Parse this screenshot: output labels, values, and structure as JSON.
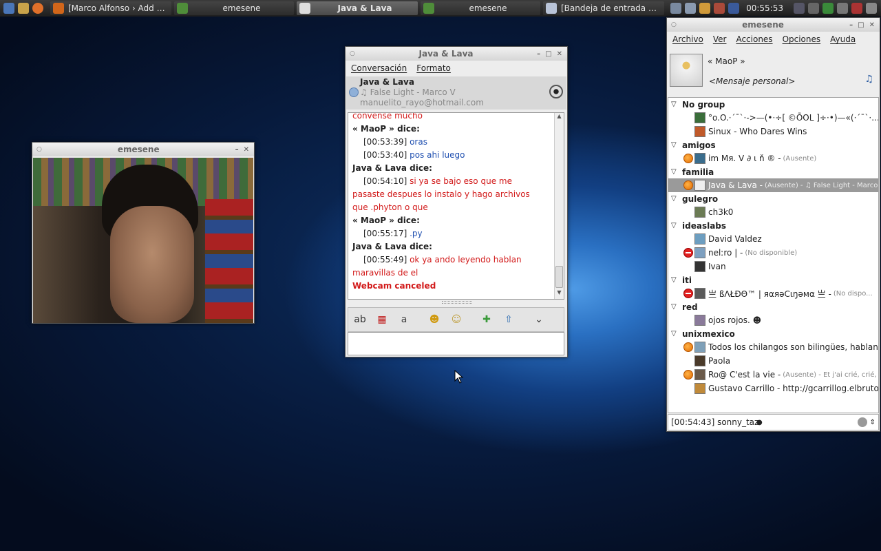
{
  "taskbar": {
    "tasks": [
      {
        "label": "[Marco Alfonso › Add Ne...",
        "icon": "firefox-icon",
        "color": "#d2661a",
        "active": false
      },
      {
        "label": "emesene",
        "icon": "emesene-icon",
        "color": "#4f8d3a",
        "active": false
      },
      {
        "label": "Java & Lava",
        "icon": "chat-window-icon",
        "color": "#dddddd",
        "active": true
      },
      {
        "label": "emesene",
        "icon": "emesene-icon",
        "color": "#4f8d3a",
        "active": false
      },
      {
        "label": "[Bandeja de entrada para ...",
        "icon": "mail-icon",
        "color": "#b9c4d8",
        "active": false
      }
    ],
    "clock": "00:55:53"
  },
  "webcam_window": {
    "title": "emesene"
  },
  "chat_window": {
    "title": "Java & Lava",
    "menu": [
      "Conversación",
      "Formato"
    ],
    "contact_name": "Java & Lava",
    "contact_music": "♫ False Light - Marco V",
    "contact_email": "manuelito_rayo@hotmail.com",
    "messages": [
      {
        "text": "convense mucho",
        "class": "red"
      },
      {
        "text": "« MaoP » dice:",
        "class": "bold"
      },
      {
        "time": "[00:53:39]",
        "text": "oras",
        "class": "blue"
      },
      {
        "time": "[00:53:40]",
        "text": "pos ahi luego",
        "class": "blue"
      },
      {
        "text": "Java & Lava dice:",
        "class": "bold"
      },
      {
        "time": "[00:54:10]",
        "text": "si ya se bajo eso que me",
        "class": "red"
      },
      {
        "text": "pasaste despues lo instalo y hago archivos",
        "class": "red"
      },
      {
        "text": "que .phyton o que",
        "class": "red"
      },
      {
        "text": "« MaoP » dice:",
        "class": "bold"
      },
      {
        "time": "[00:55:17]",
        "text": ".py",
        "class": "blue"
      },
      {
        "text": "Java & Lava dice:",
        "class": "bold"
      },
      {
        "time": "[00:55:49]",
        "text": "ok ya ando leyendo hablan",
        "class": "red"
      },
      {
        "text": "maravillas de el",
        "class": "red"
      },
      {
        "text": "Webcam canceled",
        "class": "bold red"
      }
    ],
    "toolbar": [
      {
        "icon": "font-icon",
        "glyph": "ab"
      },
      {
        "icon": "font-color-icon",
        "glyph": "▦"
      },
      {
        "icon": "text-format-icon",
        "glyph": "a"
      },
      {
        "icon": "emoticon-icon",
        "glyph": "☻"
      },
      {
        "icon": "wink-icon",
        "glyph": "☺"
      },
      {
        "icon": "invite-icon",
        "glyph": "✚"
      },
      {
        "icon": "send-file-icon",
        "glyph": "⇧"
      },
      {
        "icon": "more-icon",
        "glyph": "⌄"
      }
    ]
  },
  "main_window": {
    "title": "emesene",
    "menu": [
      "Archivo",
      "Ver",
      "Acciones",
      "Opciones",
      "Ayuda"
    ],
    "nick": "« MaoP »",
    "personal_message": "<Mensaje personal>",
    "groups": [
      {
        "name": "No group",
        "contacts": [
          {
            "name": "°o.O.·´¯`·->—(•·÷[ ©ÕOL ]÷·•)—«(·´¯`·...",
            "status": "none",
            "avatar": "#3a6d3a"
          },
          {
            "name": "Sinux - Who Dares Wins",
            "status": "none",
            "avatar": "#c05a2a"
          }
        ]
      },
      {
        "name": "amigos",
        "contacts": [
          {
            "name": "im Mя. V ∂ ι ň ® -",
            "note": "(Ausente)",
            "status": "away",
            "avatar": "#3a6d8d"
          }
        ]
      },
      {
        "name": "familia",
        "contacts": [
          {
            "name": "Java & Lava -",
            "note": "(Ausente) - ♫ False Light - Marco V",
            "status": "away",
            "avatar": "#eeeeee",
            "selected": true
          }
        ]
      },
      {
        "name": "gulegro",
        "contacts": [
          {
            "name": "ch3k0",
            "status": "none",
            "avatar": "#6b7b55"
          }
        ]
      },
      {
        "name": "ideaslabs",
        "contacts": [
          {
            "name": "David Valdez",
            "status": "none",
            "avatar": "#6d9ec0"
          },
          {
            "name": "nelːro | -",
            "note": "(No disponible)",
            "status": "busy",
            "avatar": "#7ea0c0"
          },
          {
            "name": "Ivan",
            "status": "none",
            "avatar": "#333333"
          }
        ]
      },
      {
        "name": "iti",
        "contacts": [
          {
            "name": "亗 ßΛŁÐΘ™ | яαяәϹιŋәмα 亗 -",
            "note": "(No dispo...",
            "status": "busy",
            "avatar": "#5a5a5a"
          }
        ]
      },
      {
        "name": "red",
        "contacts": [
          {
            "name": "ojos rojos. ☻",
            "status": "none",
            "avatar": "#8a7a9a"
          }
        ]
      },
      {
        "name": "unixmexico",
        "contacts": [
          {
            "name": "Todos los chilangos son bilingües, hablan es...",
            "status": "away",
            "avatar": "#7fa0b8"
          },
          {
            "name": "Paola",
            "status": "none",
            "avatar": "#4a3a2a"
          },
          {
            "name": "Ro@  C'est la vie -",
            "note": "(Ausente) - Et j'ai crié, crié, Ali...",
            "status": "away",
            "avatar": "#6a5a4a"
          },
          {
            "name": "Gustavo Carrillo - http://gcarrillog.elbruto.es/",
            "status": "none",
            "avatar": "#c08a3a"
          }
        ]
      }
    ],
    "status_text": "[00:54:43] sonny_taz "
  }
}
